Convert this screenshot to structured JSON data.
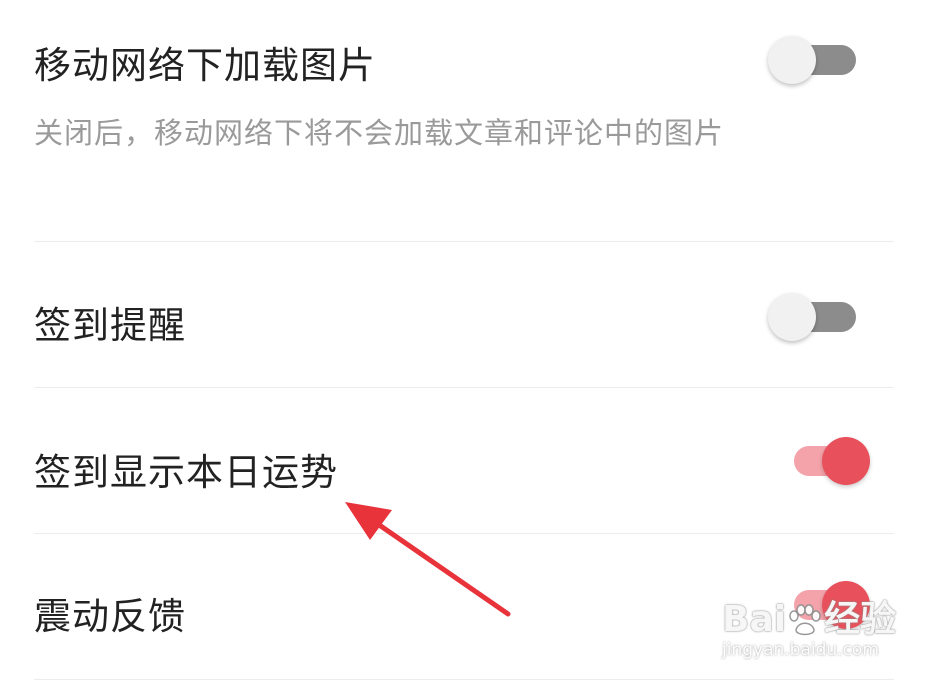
{
  "settings": [
    {
      "title": "移动网络下加载图片",
      "description": "关闭后，移动网络下将不会加载文章和评论中的图片",
      "enabled": false
    },
    {
      "title": "签到提醒",
      "enabled": false
    },
    {
      "title": "签到显示本日运势",
      "enabled": true
    },
    {
      "title": "震动反馈",
      "enabled": true
    }
  ],
  "colors": {
    "accent": "#e8505b",
    "accent_track": "#f4a3aa",
    "off_track": "#8c8c8c",
    "off_thumb": "#f1f1f1",
    "annotation_arrow": "#e8333a"
  },
  "watermark": {
    "brand_left": "Bai",
    "brand_right": "经验",
    "url": "jingyan.baidu.com"
  }
}
